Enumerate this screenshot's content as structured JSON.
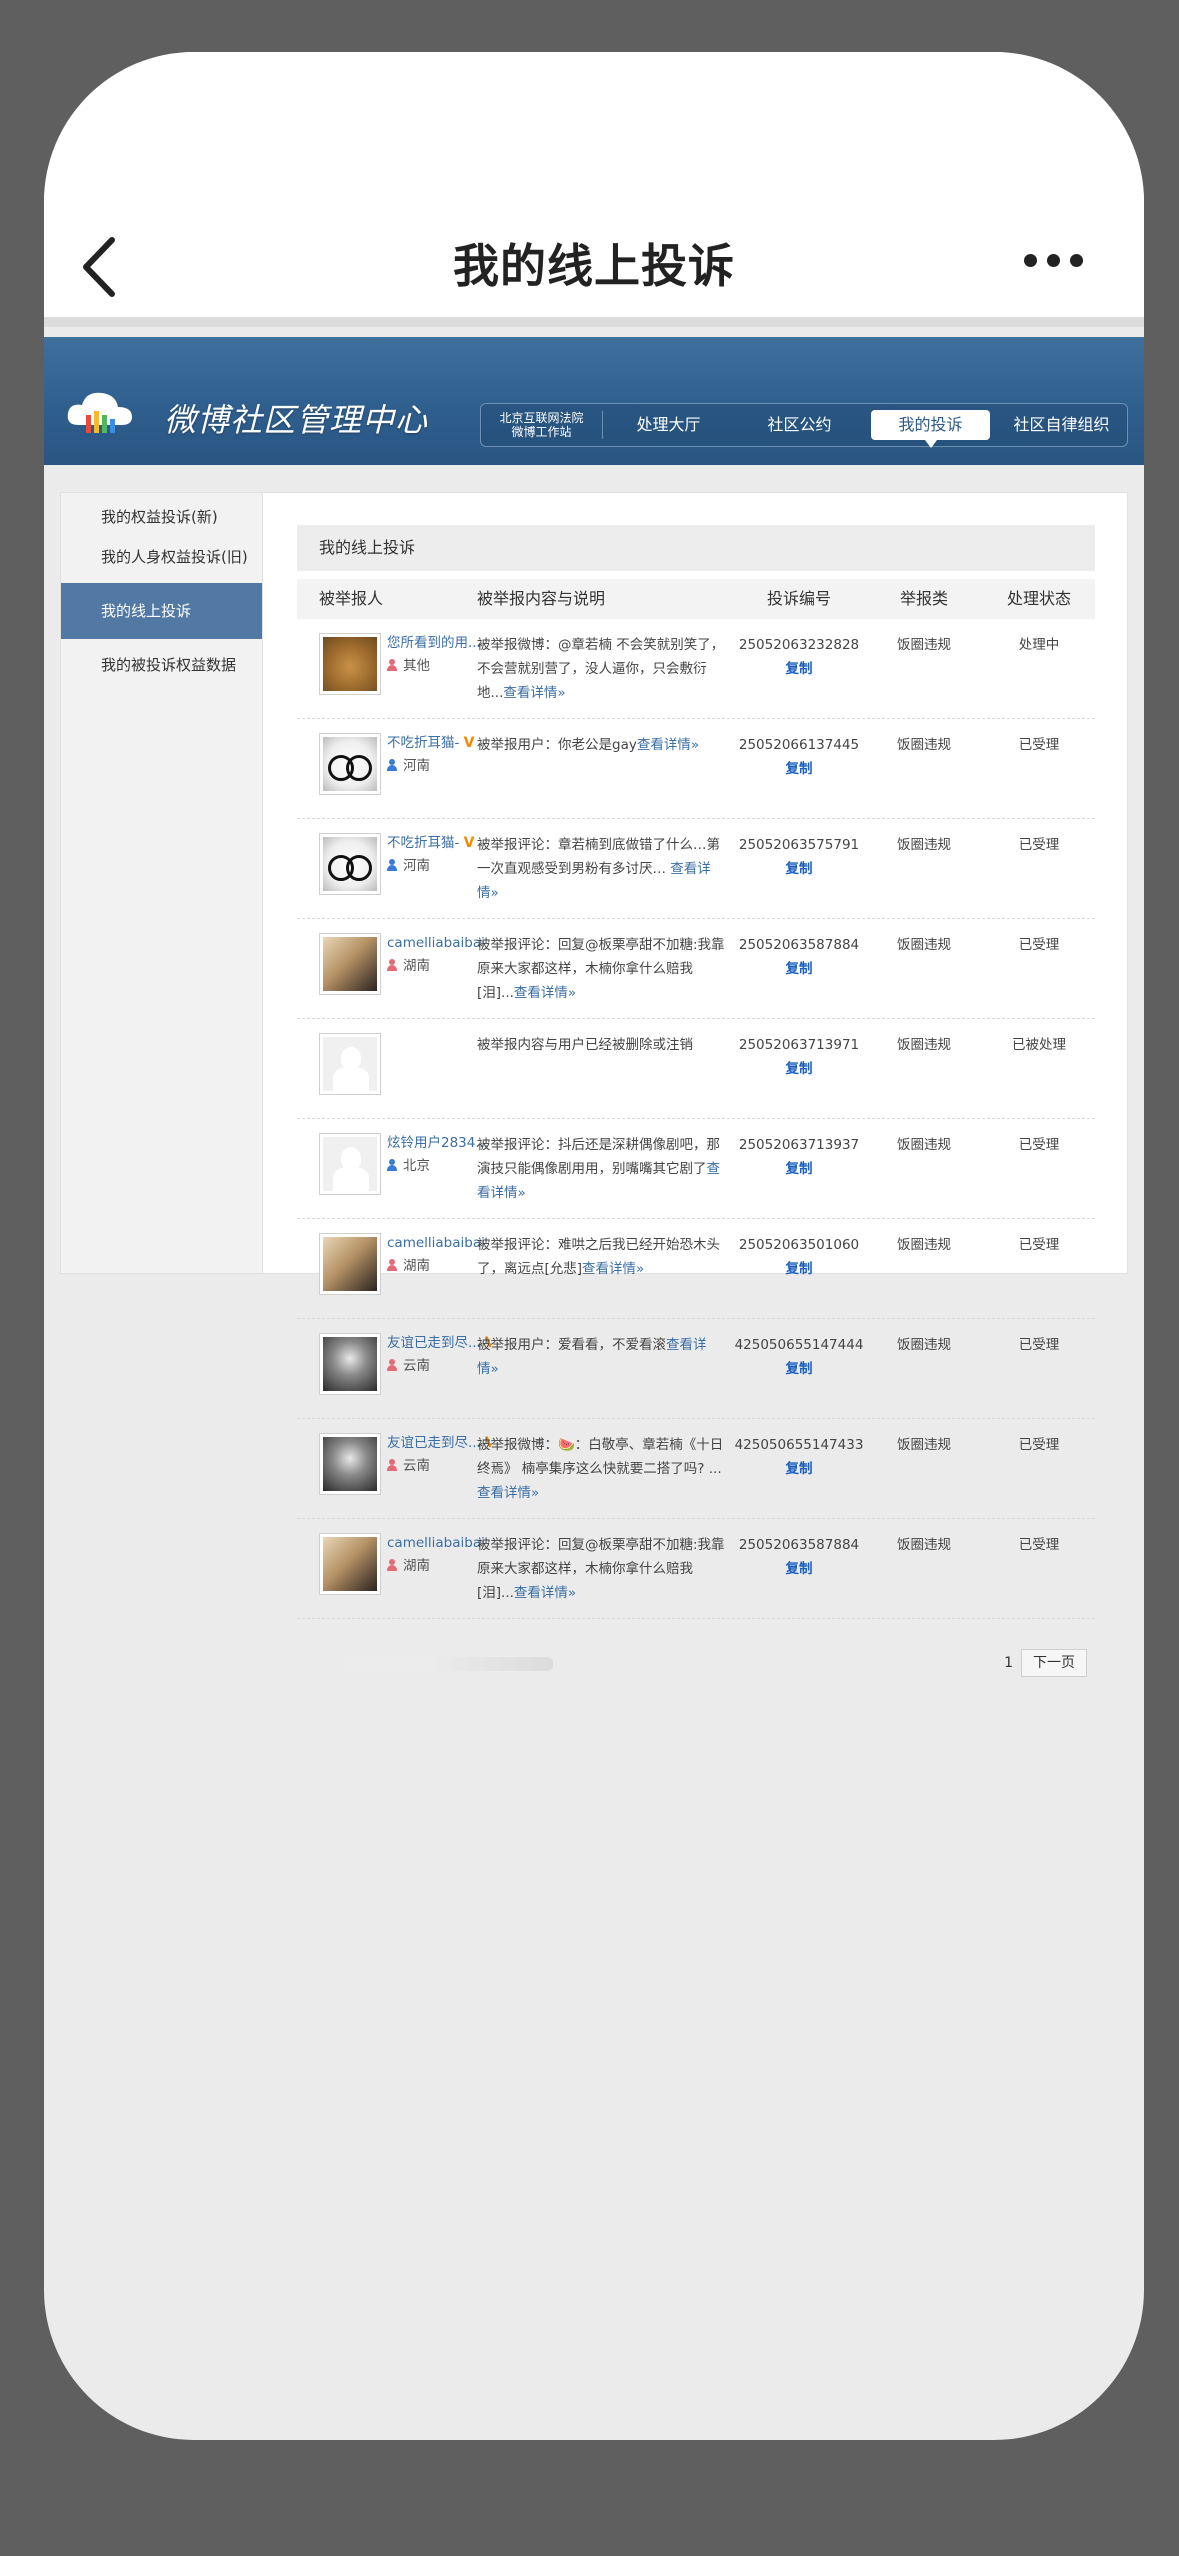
{
  "app": {
    "title": "我的线上投诉"
  },
  "banner": {
    "title": "微博社区管理中心",
    "court_line1": "北京互联网法院",
    "court_line2": "微博工作站",
    "nav": [
      "处理大厅",
      "社区公约",
      "我的投诉",
      "社区自律组织"
    ],
    "active_nav": "我的投诉"
  },
  "sidebar": {
    "items": [
      "我的权益投诉(新)",
      "我的人身权益投诉(旧)",
      "我的线上投诉",
      "我的被投诉权益数据"
    ],
    "active_item": "我的线上投诉"
  },
  "main": {
    "section_title": "我的线上投诉",
    "columns": [
      "被举报人",
      "被举报内容与说明",
      "投诉编号",
      "举报类",
      "处理状态"
    ],
    "copy_label": "复制",
    "rows": [
      {
        "avatar": "dog-avatar",
        "name": "您所看到的用...",
        "verified": false,
        "gender": "f",
        "location": "其他",
        "desc": "被举报微博：@章若楠 不会笑就别笑了，不会营就别营了，没人逼你，只会敷衍地...",
        "more": "查看详情»",
        "id": "25052063232828",
        "type": "饭圈违规",
        "status": "处理中"
      },
      {
        "avatar": "glasses-avatar",
        "name": "不吃折耳猫-",
        "verified": true,
        "gender": "m",
        "location": "河南",
        "desc": "被举报用户：你老公是gay",
        "more": "查看详情»",
        "id": "25052066137445",
        "type": "饭圈违规",
        "status": "已受理"
      },
      {
        "avatar": "glasses-avatar",
        "name": "不吃折耳猫-",
        "verified": true,
        "gender": "m",
        "location": "河南",
        "desc": "被举报评论：章若楠到底做错了什么…第一次直观感受到男粉有多讨厌… ",
        "more": "查看详情»",
        "id": "25052063575791",
        "type": "饭圈违规",
        "status": "已受理"
      },
      {
        "avatar": "girl-avatar",
        "name": "camelliabaibai",
        "verified": false,
        "gender": "f",
        "location": "湖南",
        "desc": "被举报评论：回复@板栗亭甜不加糖:我靠原来大家都这样，木楠你拿什么赔我[泪]...",
        "more": "查看详情»",
        "id": "25052063587884",
        "type": "饭圈违规",
        "status": "已受理"
      },
      {
        "avatar": "default-avatar",
        "name": "",
        "verified": false,
        "gender": "",
        "location": "",
        "desc": "被举报内容与用户已经被删除或注销",
        "more": "",
        "id": "25052063713971",
        "type": "饭圈违规",
        "status": "已被处理"
      },
      {
        "avatar": "default-avatar",
        "name": "炫铃用户2834...",
        "verified": false,
        "gender": "m",
        "location": "北京",
        "desc": "被举报评论：抖后还是深耕偶像剧吧，那演技只能偶像剧用用，别嘴嘴其它剧了",
        "more": "查看详情»",
        "id": "25052063713937",
        "type": "饭圈违规",
        "status": "已受理"
      },
      {
        "avatar": "girl-avatar",
        "name": "camelliabaibai",
        "verified": false,
        "gender": "f",
        "location": "湖南",
        "desc": "被举报评论：难哄之后我已经开始恐木头了，离远点[允悲]",
        "more": "查看详情»",
        "id": "25052063501060",
        "type": "饭圈违规",
        "status": "已受理"
      },
      {
        "avatar": "dark-avatar",
        "name": "友谊已走到尽...",
        "verified": true,
        "gender": "f",
        "location": "云南",
        "desc": "被举报用户：爱看看，不爱看滚",
        "more": "查看详情»",
        "id": "425050655147444",
        "type": "饭圈违规",
        "status": "已受理"
      },
      {
        "avatar": "dark-avatar",
        "name": "友谊已走到尽...",
        "verified": true,
        "gender": "f",
        "location": "云南",
        "desc": "被举报微博：🍉：白敬亭、章若楠《十日终焉》 楠亭集序这么快就要二搭了吗? ...",
        "more": "查看详情»",
        "id": "425050655147433",
        "type": "饭圈违规",
        "status": "已受理"
      },
      {
        "avatar": "girl-avatar",
        "name": "camelliabaibai",
        "verified": false,
        "gender": "f",
        "location": "湖南",
        "desc": "被举报评论：回复@板栗亭甜不加糖:我靠原来大家都这样，木楠你拿什么赔我[泪]...",
        "more": "查看详情»",
        "id": "25052063587884",
        "type": "饭圈违规",
        "status": "已受理"
      }
    ]
  },
  "pagination": {
    "page": "1",
    "next_label": "下一页"
  }
}
